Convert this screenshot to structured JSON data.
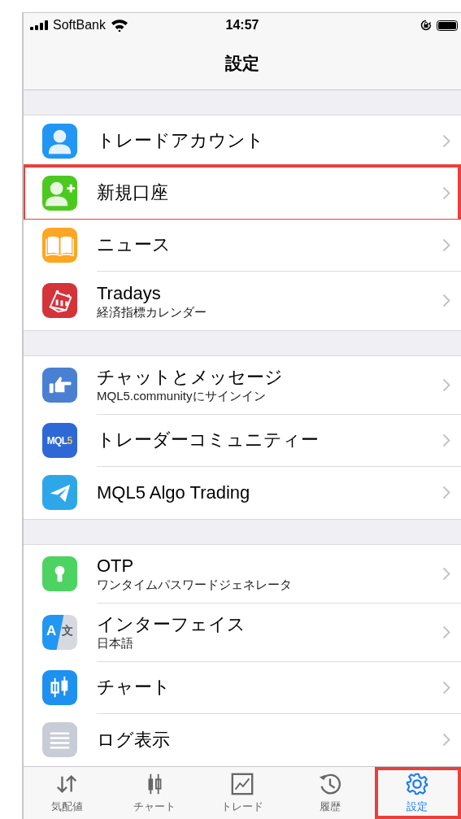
{
  "status_bar": {
    "carrier": "SoftBank",
    "time": "14:57"
  },
  "title": "設定",
  "groups": [
    {
      "items": [
        {
          "kind": "person",
          "title": "トレードアカウント",
          "highlighted": false
        },
        {
          "kind": "person-add",
          "title": "新規口座",
          "highlighted": true
        },
        {
          "kind": "book",
          "title": "ニュース",
          "highlighted": false
        },
        {
          "kind": "calendar",
          "title": "Tradays",
          "subtitle": "経済指標カレンダー",
          "highlighted": false
        }
      ]
    },
    {
      "items": [
        {
          "kind": "hand",
          "title": "チャットとメッセージ",
          "subtitle": "MQL5.communityにサインイン",
          "highlighted": false
        },
        {
          "kind": "logo",
          "icon_text": [
            "MQL",
            "5"
          ],
          "title": "トレーダーコミュニティー",
          "highlighted": false
        },
        {
          "kind": "plane",
          "title": "MQL5 Algo Trading",
          "highlighted": false
        }
      ]
    },
    {
      "items": [
        {
          "kind": "keyhole",
          "title": "OTP",
          "subtitle": "ワンタイムパスワードジェネレータ",
          "highlighted": false
        },
        {
          "kind": "translate",
          "icon_text": [
            "A",
            "文"
          ],
          "title": "インターフェイス",
          "subtitle": "日本語",
          "highlighted": false
        },
        {
          "kind": "candles",
          "title": "チャート",
          "highlighted": false
        },
        {
          "kind": "lines",
          "title": "ログ表示",
          "highlighted": false
        }
      ]
    }
  ],
  "tabs": [
    {
      "kind": "arrows",
      "label": "気配値",
      "selected": false,
      "highlighted": false
    },
    {
      "kind": "candles",
      "label": "チャート",
      "selected": false,
      "highlighted": false
    },
    {
      "kind": "trend",
      "label": "トレード",
      "selected": false,
      "highlighted": false
    },
    {
      "kind": "history",
      "label": "履歴",
      "selected": false,
      "highlighted": false
    },
    {
      "kind": "gear",
      "label": "設定",
      "selected": true,
      "highlighted": true
    }
  ]
}
